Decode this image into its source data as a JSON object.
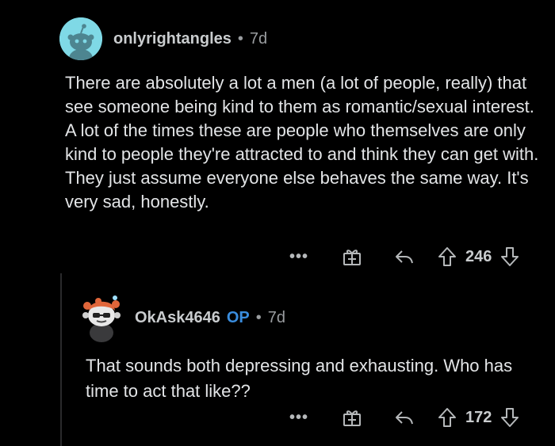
{
  "comment": {
    "username": "onlyrightangles",
    "separator": "•",
    "age": "7d",
    "body": "There are absolutely a lot a men (a lot of people, really) that see someone being kind to them as romantic/sexual interest. A lot of the times these are people who themselves are only kind to people they're attracted to and think they can get with. They just assume everyone else behaves the same way. It's very sad, honestly.",
    "actions": {
      "more": "•••",
      "score": "246"
    }
  },
  "reply": {
    "username": "OkAsk4646",
    "op_badge": "OP",
    "separator": "•",
    "age": "7d",
    "body": "That sounds both depressing and exhausting. Who has time to act that like??",
    "actions": {
      "more": "•••",
      "score": "172"
    }
  },
  "colors": {
    "background": "#000000",
    "text": "#e3e5e7",
    "muted": "#9a9da0",
    "op_accent": "#3a8dde",
    "avatar_1_bg": "#7fd9e6"
  },
  "icons": [
    "snoo-avatar-icon",
    "gift-icon",
    "reply-icon",
    "upvote-icon",
    "downvote-icon"
  ]
}
